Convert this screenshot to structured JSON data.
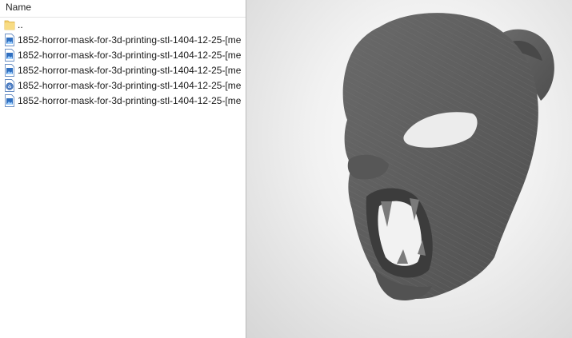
{
  "file_list": {
    "column_name": "Name",
    "parent_label": "..",
    "files": [
      {
        "name": "1852-horror-mask-for-3d-printing-stl-1404-12-25-[me",
        "icon": "image-file-icon"
      },
      {
        "name": "1852-horror-mask-for-3d-printing-stl-1404-12-25-[me",
        "icon": "image-file-icon"
      },
      {
        "name": "1852-horror-mask-for-3d-printing-stl-1404-12-25-[me",
        "icon": "image-file-icon"
      },
      {
        "name": "1852-horror-mask-for-3d-printing-stl-1404-12-25-[me",
        "icon": "3d-model-file-icon"
      },
      {
        "name": "1852-horror-mask-for-3d-printing-stl-1404-12-25-[me",
        "icon": "image-file-icon"
      }
    ]
  },
  "viewer": {
    "model_color": "#5f5f5f",
    "background_color": "#e4e4e4"
  }
}
